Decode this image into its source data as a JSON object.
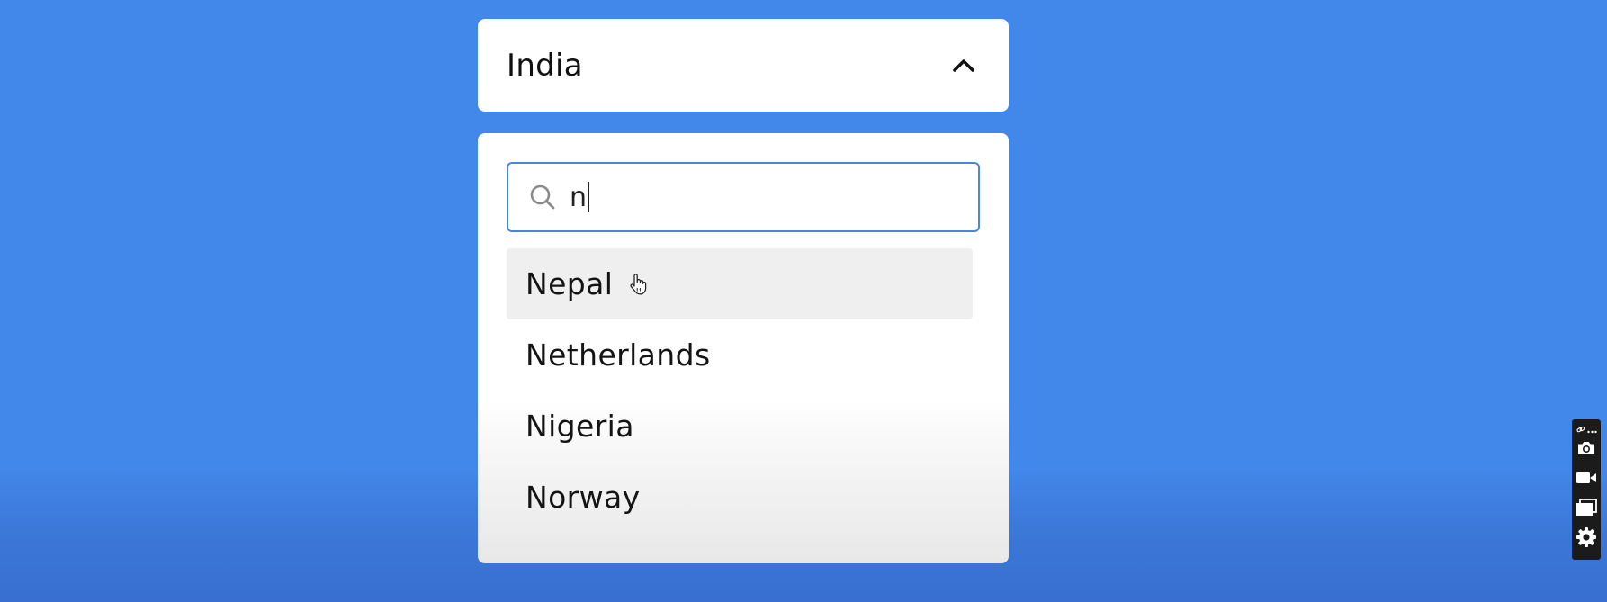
{
  "select": {
    "value": "India"
  },
  "search": {
    "query": "n"
  },
  "options": [
    {
      "label": "Nepal"
    },
    {
      "label": "Netherlands"
    },
    {
      "label": "Nigeria"
    },
    {
      "label": "Norway"
    }
  ],
  "icons": {
    "chevron": "chevron-up-icon",
    "search": "search-icon",
    "pointer": "hand-pointer-icon",
    "toolbar": [
      "link-icon",
      "more-icon",
      "camera-icon",
      "video-camera-icon",
      "window-capture-icon",
      "gear-icon"
    ]
  },
  "colors": {
    "background": "#4287ea",
    "focus_border": "#4a86e0",
    "hover_row": "#efefef",
    "toolbar": "#1b1b1b"
  }
}
